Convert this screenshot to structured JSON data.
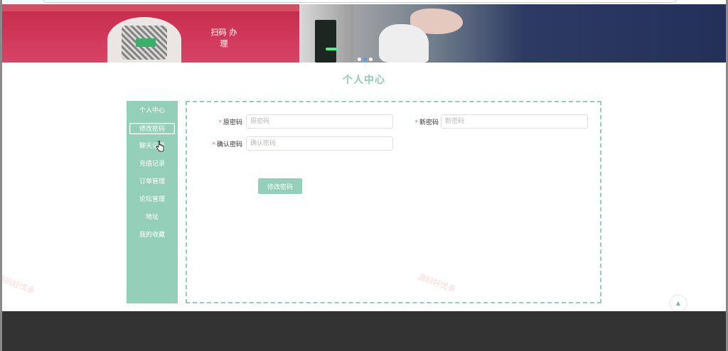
{
  "page": {
    "title": "个人中心"
  },
  "sidebar": {
    "items": [
      {
        "label": "个人中心",
        "active": false
      },
      {
        "label": "修改密码",
        "active": true
      },
      {
        "label": "聊天记录",
        "active": false
      },
      {
        "label": "充值记录",
        "active": false
      },
      {
        "label": "订单管理",
        "active": false
      },
      {
        "label": "论坛管理",
        "active": false
      },
      {
        "label": "地址",
        "active": false
      },
      {
        "label": "我的收藏",
        "active": false
      }
    ]
  },
  "form": {
    "old_password_label": "原密码",
    "old_password_placeholder": "原密码",
    "old_password_value": "",
    "new_password_label": "新密码",
    "new_password_placeholder": "新密码",
    "new_password_value": "",
    "confirm_password_label": "确认密码",
    "confirm_password_placeholder": "确认密码",
    "confirm_password_value": "",
    "required_mark": "*",
    "submit_label": "修改密码"
  },
  "banner": {
    "scan_text": "扫码 办理"
  },
  "watermark": {
    "text": "源码好优多"
  },
  "colors": {
    "accent": "#94d0b9",
    "title": "#8fccb6",
    "required": "#f56c6c",
    "footer": "#333333"
  },
  "icons": {
    "back_to_top": "chevron-up-icon",
    "cursor": "hand-pointer-icon"
  }
}
